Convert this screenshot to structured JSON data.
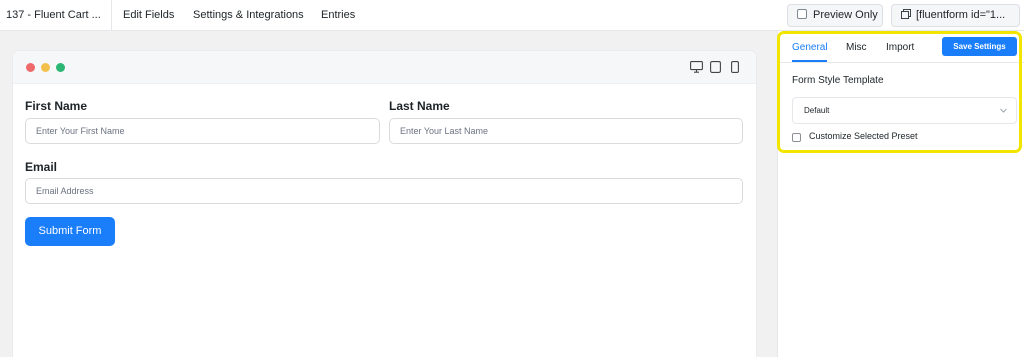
{
  "topbar": {
    "form_title": "137 - Fluent Cart ...",
    "tabs": [
      "Edit Fields",
      "Settings & Integrations",
      "Entries"
    ],
    "preview_label": "Preview Only",
    "shortcode": "[fluentform id=\"1..."
  },
  "form": {
    "first_name": {
      "label": "First Name",
      "placeholder": "Enter Your First Name"
    },
    "last_name": {
      "label": "Last Name",
      "placeholder": "Enter Your Last Name"
    },
    "email": {
      "label": "Email",
      "placeholder": "Email Address"
    },
    "submit_label": "Submit Form"
  },
  "panel": {
    "tabs": [
      "General",
      "Misc",
      "Import"
    ],
    "save_label": "Save Settings",
    "style_template_label": "Form Style Template",
    "style_template_value": "Default",
    "customize_label": "Customize Selected Preset"
  },
  "colors": {
    "accent": "#1a7efb",
    "highlight": "#f2e600",
    "dot_red": "#ee6a6a",
    "dot_yellow": "#f3c04b",
    "dot_green": "#2bb673"
  },
  "icons": [
    "copy-icon",
    "desktop-icon",
    "tablet-icon",
    "mobile-icon",
    "chevron-down-icon"
  ]
}
